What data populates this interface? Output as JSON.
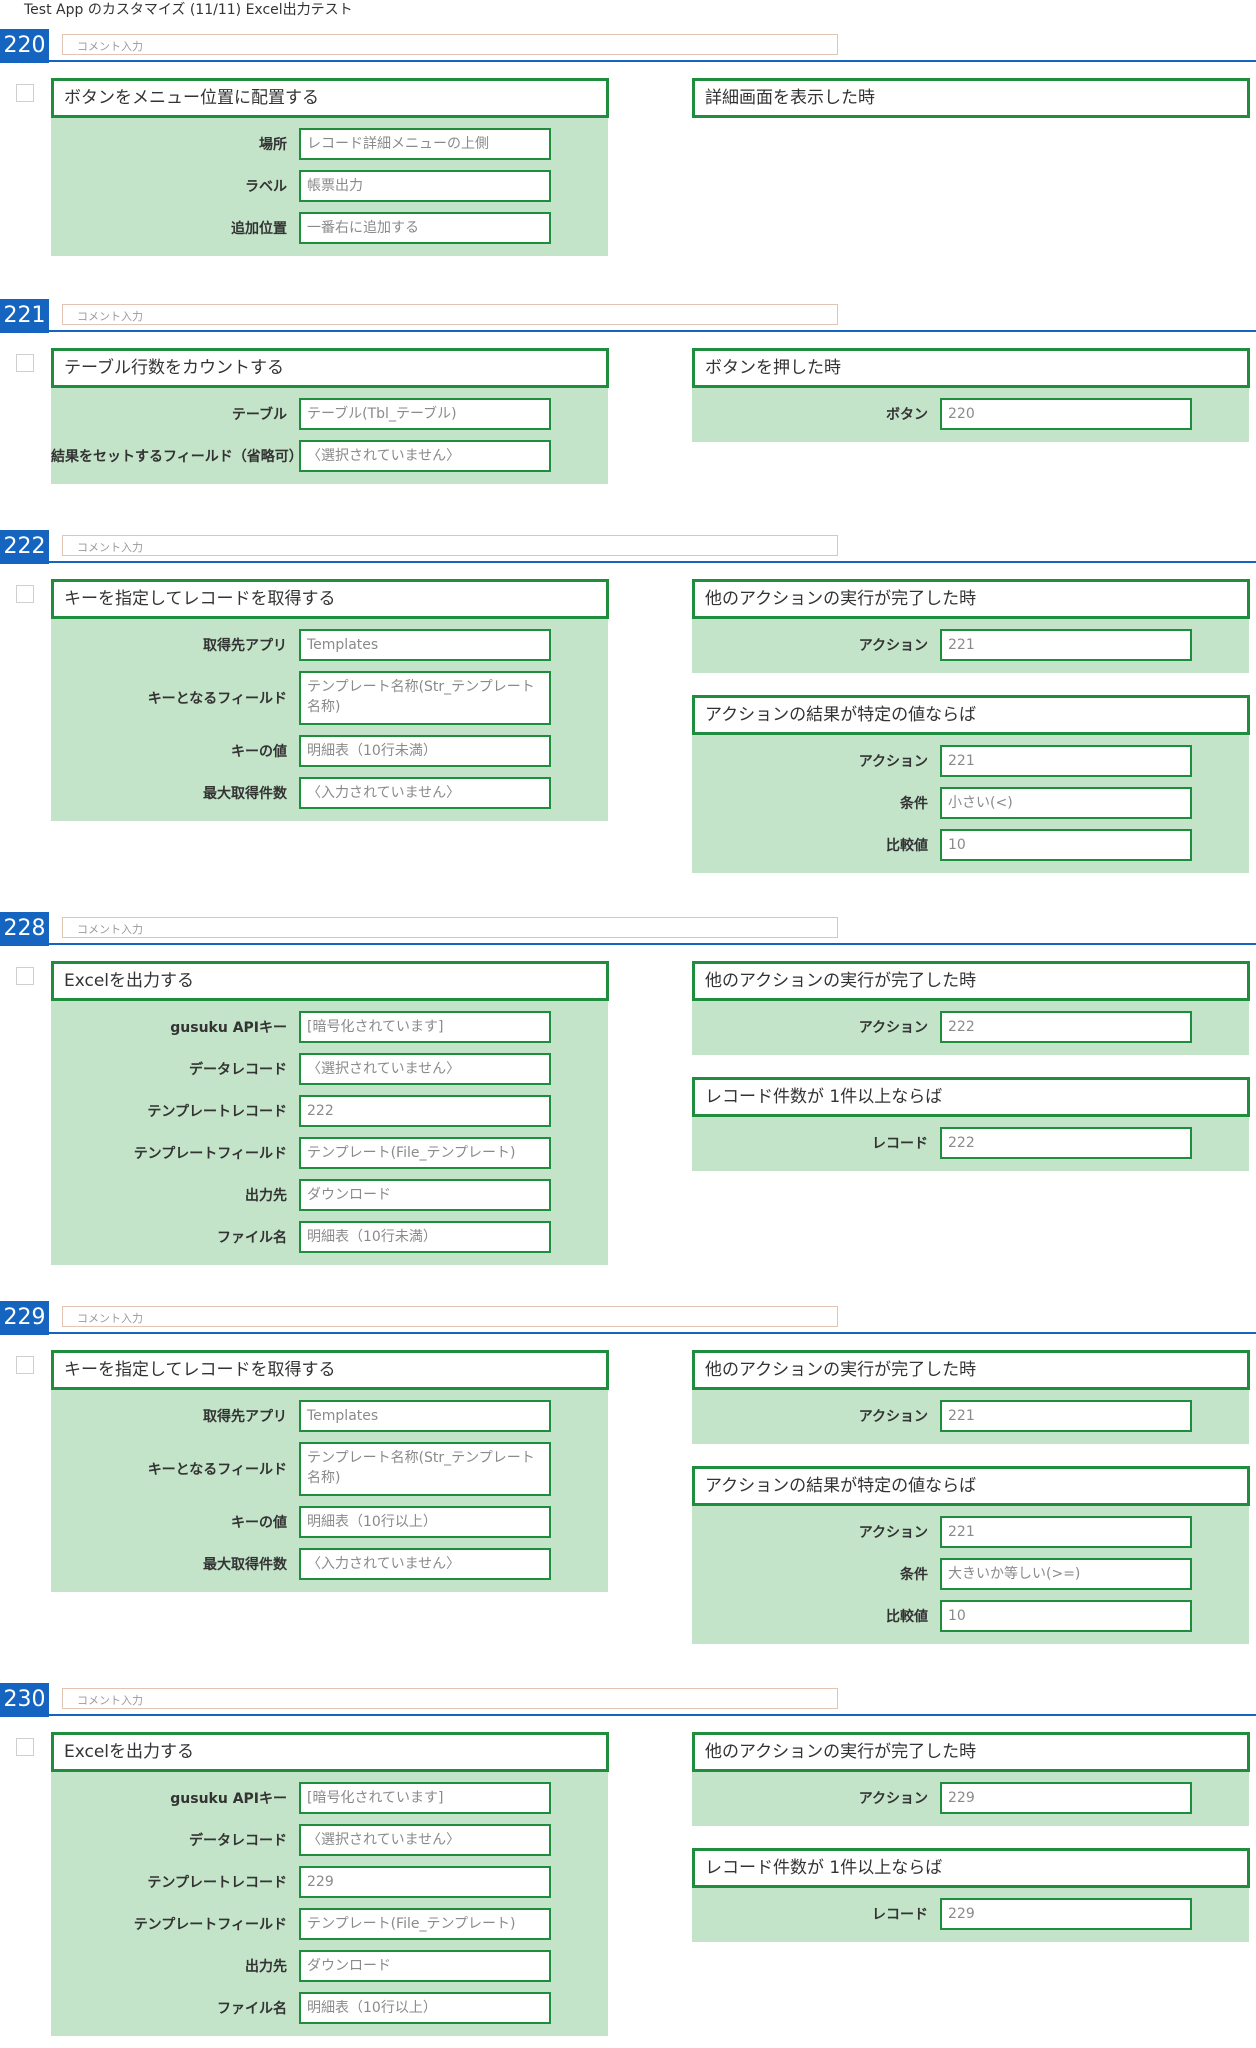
{
  "page_title": "Test App のカスタマイズ (11/11) Excel出力テスト",
  "comment_placeholder": "コメント入力",
  "actions": [
    {
      "number": "220",
      "action": {
        "title": "ボタンをメニュー位置に配置する",
        "fields": [
          {
            "label": "場所",
            "value": "レコード詳細メニューの上側"
          },
          {
            "label": "ラベル",
            "value": "帳票出力"
          },
          {
            "label": "追加位置",
            "value": "一番右に追加する"
          }
        ]
      },
      "conditions": [
        {
          "title": "詳細画面を表示した時",
          "fields": []
        }
      ]
    },
    {
      "number": "221",
      "action": {
        "title": "テーブル行数をカウントする",
        "fields": [
          {
            "label": "テーブル",
            "value": "テーブル(Tbl_テーブル)"
          },
          {
            "label": "結果をセットするフィールド（省略可）",
            "value": "〈選択されていません〉"
          }
        ]
      },
      "conditions": [
        {
          "title": "ボタンを押した時",
          "fields": [
            {
              "label": "ボタン",
              "value": "220"
            }
          ]
        }
      ]
    },
    {
      "number": "222",
      "action": {
        "title": "キーを指定してレコードを取得する",
        "fields": [
          {
            "label": "取得先アプリ",
            "value": "Templates"
          },
          {
            "label": "キーとなるフィールド",
            "value": "テンプレート名称(Str_テンプレート名称)",
            "tall": true
          },
          {
            "label": "キーの値",
            "value": "明細表（10行未満）"
          },
          {
            "label": "最大取得件数",
            "value": "〈入力されていません〉"
          }
        ]
      },
      "conditions": [
        {
          "title": "他のアクションの実行が完了した時",
          "fields": [
            {
              "label": "アクション",
              "value": "221"
            }
          ]
        },
        {
          "title": "アクションの結果が特定の値ならば",
          "fields": [
            {
              "label": "アクション",
              "value": "221"
            },
            {
              "label": "条件",
              "value": "小さい(<)"
            },
            {
              "label": "比較値",
              "value": "10"
            }
          ]
        }
      ]
    },
    {
      "number": "228",
      "action": {
        "title": "Excelを出力する",
        "fields": [
          {
            "label": "gusuku APIキー",
            "value": "[暗号化されています]"
          },
          {
            "label": "データレコード",
            "value": "〈選択されていません〉"
          },
          {
            "label": "テンプレートレコード",
            "value": "222"
          },
          {
            "label": "テンプレートフィールド",
            "value": "テンプレート(File_テンプレート)"
          },
          {
            "label": "出力先",
            "value": "ダウンロード"
          },
          {
            "label": "ファイル名",
            "value": "明細表（10行未満）"
          }
        ]
      },
      "conditions": [
        {
          "title": "他のアクションの実行が完了した時",
          "fields": [
            {
              "label": "アクション",
              "value": "222"
            }
          ]
        },
        {
          "title": "レコード件数が 1件以上ならば",
          "fields": [
            {
              "label": "レコード",
              "value": "222"
            }
          ]
        }
      ]
    },
    {
      "number": "229",
      "action": {
        "title": "キーを指定してレコードを取得する",
        "fields": [
          {
            "label": "取得先アプリ",
            "value": "Templates"
          },
          {
            "label": "キーとなるフィールド",
            "value": "テンプレート名称(Str_テンプレート名称)",
            "tall": true
          },
          {
            "label": "キーの値",
            "value": "明細表（10行以上）"
          },
          {
            "label": "最大取得件数",
            "value": "〈入力されていません〉"
          }
        ]
      },
      "conditions": [
        {
          "title": "他のアクションの実行が完了した時",
          "fields": [
            {
              "label": "アクション",
              "value": "221"
            }
          ]
        },
        {
          "title": "アクションの結果が特定の値ならば",
          "fields": [
            {
              "label": "アクション",
              "value": "221"
            },
            {
              "label": "条件",
              "value": "大きいか等しい(>=)"
            },
            {
              "label": "比較値",
              "value": "10"
            }
          ]
        }
      ]
    },
    {
      "number": "230",
      "action": {
        "title": "Excelを出力する",
        "fields": [
          {
            "label": "gusuku APIキー",
            "value": "[暗号化されています]"
          },
          {
            "label": "データレコード",
            "value": "〈選択されていません〉"
          },
          {
            "label": "テンプレートレコード",
            "value": "229"
          },
          {
            "label": "テンプレートフィールド",
            "value": "テンプレート(File_テンプレート)"
          },
          {
            "label": "出力先",
            "value": "ダウンロード"
          },
          {
            "label": "ファイル名",
            "value": "明細表（10行以上）"
          }
        ]
      },
      "conditions": [
        {
          "title": "他のアクションの実行が完了した時",
          "fields": [
            {
              "label": "アクション",
              "value": "229"
            }
          ]
        },
        {
          "title": "レコード件数が 1件以上ならば",
          "fields": [
            {
              "label": "レコード",
              "value": "229"
            }
          ]
        }
      ]
    }
  ]
}
